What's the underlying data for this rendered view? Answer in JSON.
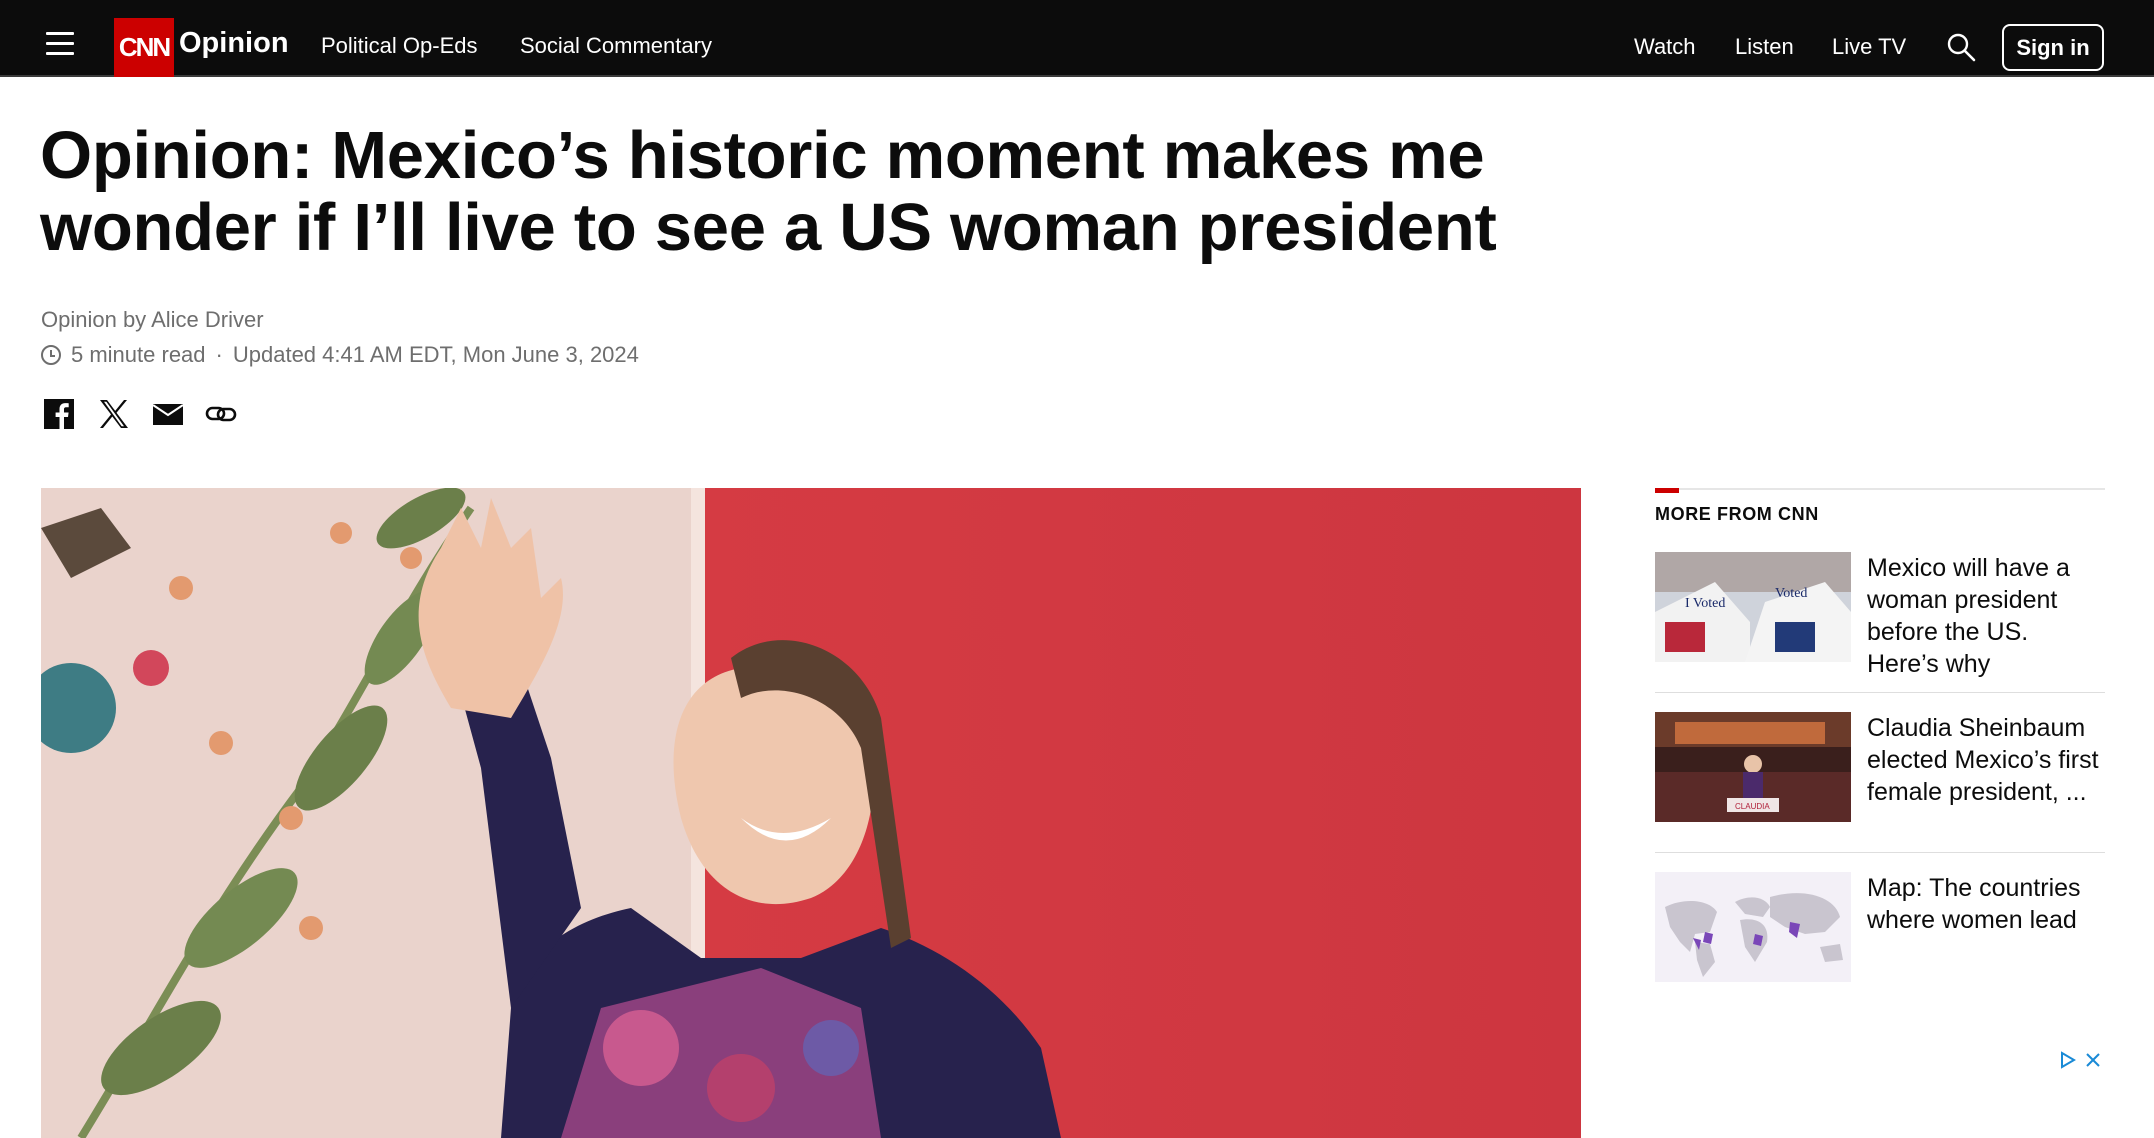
{
  "header": {
    "section": "Opinion",
    "logo_text": "CNN",
    "nav": [
      "Political Op-Eds",
      "Social Commentary"
    ],
    "right_nav": [
      "Watch",
      "Listen",
      "Live TV"
    ],
    "signin": "Sign in"
  },
  "article": {
    "headline": "Opinion: Mexico’s historic moment makes me wonder if I’ll live to see a US woman president",
    "byline_prefix": "Opinion by",
    "author": "Alice Driver",
    "read_time": "5 minute read",
    "updated": "Updated 4:41 AM EDT, Mon June 3, 2024"
  },
  "sidebar": {
    "title": "MORE FROM CNN",
    "stories": [
      {
        "title": "Mexico will have a woman president before the US. Here’s why"
      },
      {
        "title": "Claudia Sheinbaum elected Mexico’s first female president, ..."
      },
      {
        "title": "Map: The countries where women lead"
      }
    ]
  },
  "colors": {
    "brand_red": "#cc0000",
    "header_bg": "#0c0c0c",
    "meta_gray": "#6e6e6e"
  },
  "icons": [
    "menu-icon",
    "search-icon",
    "facebook-icon",
    "x-icon",
    "email-icon",
    "link-icon",
    "clock-icon",
    "adchoices-icon",
    "close-icon"
  ]
}
